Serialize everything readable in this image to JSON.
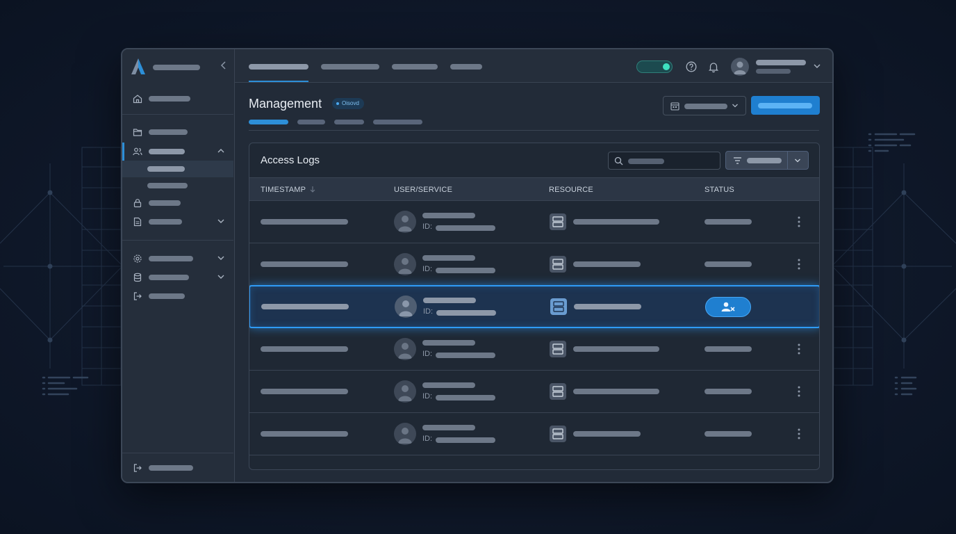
{
  "page": {
    "title": "Management",
    "badge": "Oisovd"
  },
  "card": {
    "title": "Access Logs",
    "columns": [
      "TIMESTAMP",
      "USER/SERVICE",
      "RESOURCE",
      "STATUS"
    ]
  },
  "rows": [
    {
      "id_label": "ID:",
      "selected": false
    },
    {
      "id_label": "ID:",
      "selected": false
    },
    {
      "id_label": "ID:",
      "selected": true
    },
    {
      "id_label": "ID:",
      "selected": false
    },
    {
      "id_label": "ID:",
      "selected": false
    },
    {
      "id_label": "ID:",
      "selected": false
    }
  ],
  "icons": {
    "sidebar": [
      "home-icon",
      "folder-icon",
      "users-icon",
      "lock-icon",
      "document-icon",
      "settings-icon",
      "database-icon",
      "logout-icon"
    ],
    "topbar": [
      "help-icon",
      "bell-icon",
      "avatar",
      "chevron-down-icon"
    ],
    "status_selected": "user-remove-icon",
    "row_action": "kebab-menu-icon"
  },
  "colors": {
    "accent": "#2d8fd8",
    "highlight_border": "#2f9bf5",
    "toggle_on": "#3ee0c0",
    "background": "#0f1829"
  }
}
